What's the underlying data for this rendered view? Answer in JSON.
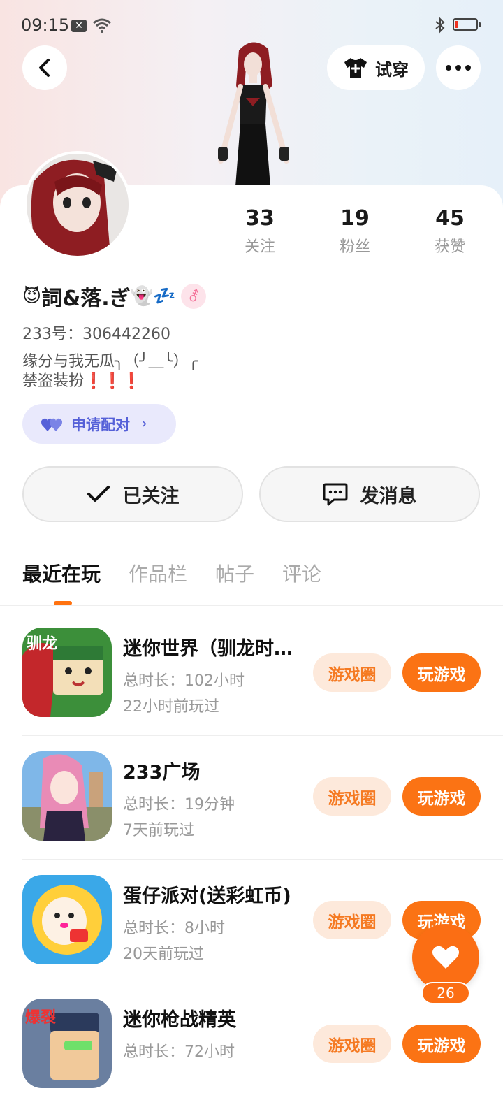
{
  "status_bar": {
    "time": "09:15"
  },
  "header": {
    "try_on_label": "试穿"
  },
  "stats": [
    {
      "value": "33",
      "label": "关注"
    },
    {
      "value": "19",
      "label": "粉丝"
    },
    {
      "value": "45",
      "label": "获赞"
    }
  ],
  "profile": {
    "name_prefix_emoji": "😈",
    "name": "詞&落.ぎ",
    "name_suffix_emoji": "👻💤",
    "gender_symbol": "⚦",
    "uid": "233号：306442260",
    "bio_line1": "缘分与我无瓜╮（╯＿╰）╭",
    "bio_line2": "禁盗装扮",
    "bio_marks": "❗❗❗",
    "match_label": "申请配对"
  },
  "actions": {
    "follow_label": "已关注",
    "message_label": "发消息"
  },
  "tabs": [
    {
      "label": "最近在玩",
      "active": true
    },
    {
      "label": "作品栏",
      "active": false
    },
    {
      "label": "帖子",
      "active": false
    },
    {
      "label": "评论",
      "active": false
    }
  ],
  "games": [
    {
      "title": "迷你世界（驯龙时…",
      "duration": "总时长：102小时",
      "last_played": "22小时前玩过",
      "circle_label": "游戏圈",
      "play_label": "玩游戏",
      "icon": "mini-world-dragon-icon"
    },
    {
      "title": "233广场",
      "duration": "总时长：19分钟",
      "last_played": "7天前玩过",
      "circle_label": "游戏圈",
      "play_label": "玩游戏",
      "icon": "plaza-233-icon"
    },
    {
      "title": "蛋仔派对(送彩虹币)",
      "duration": "总时长：8小时",
      "last_played": "20天前玩过",
      "circle_label": "游戏圈",
      "play_label": "玩游戏",
      "icon": "eggy-party-icon"
    },
    {
      "title": "迷你枪战精英",
      "duration": "总时长：72小时",
      "last_played": "",
      "circle_label": "游戏圈",
      "play_label": "玩游戏",
      "icon": "mini-gun-elite-icon"
    }
  ],
  "like_fab": {
    "count": "26"
  },
  "colors": {
    "accent": "#fb7314",
    "match_bg": "#e9e9fc",
    "match_text": "#5560d8"
  }
}
